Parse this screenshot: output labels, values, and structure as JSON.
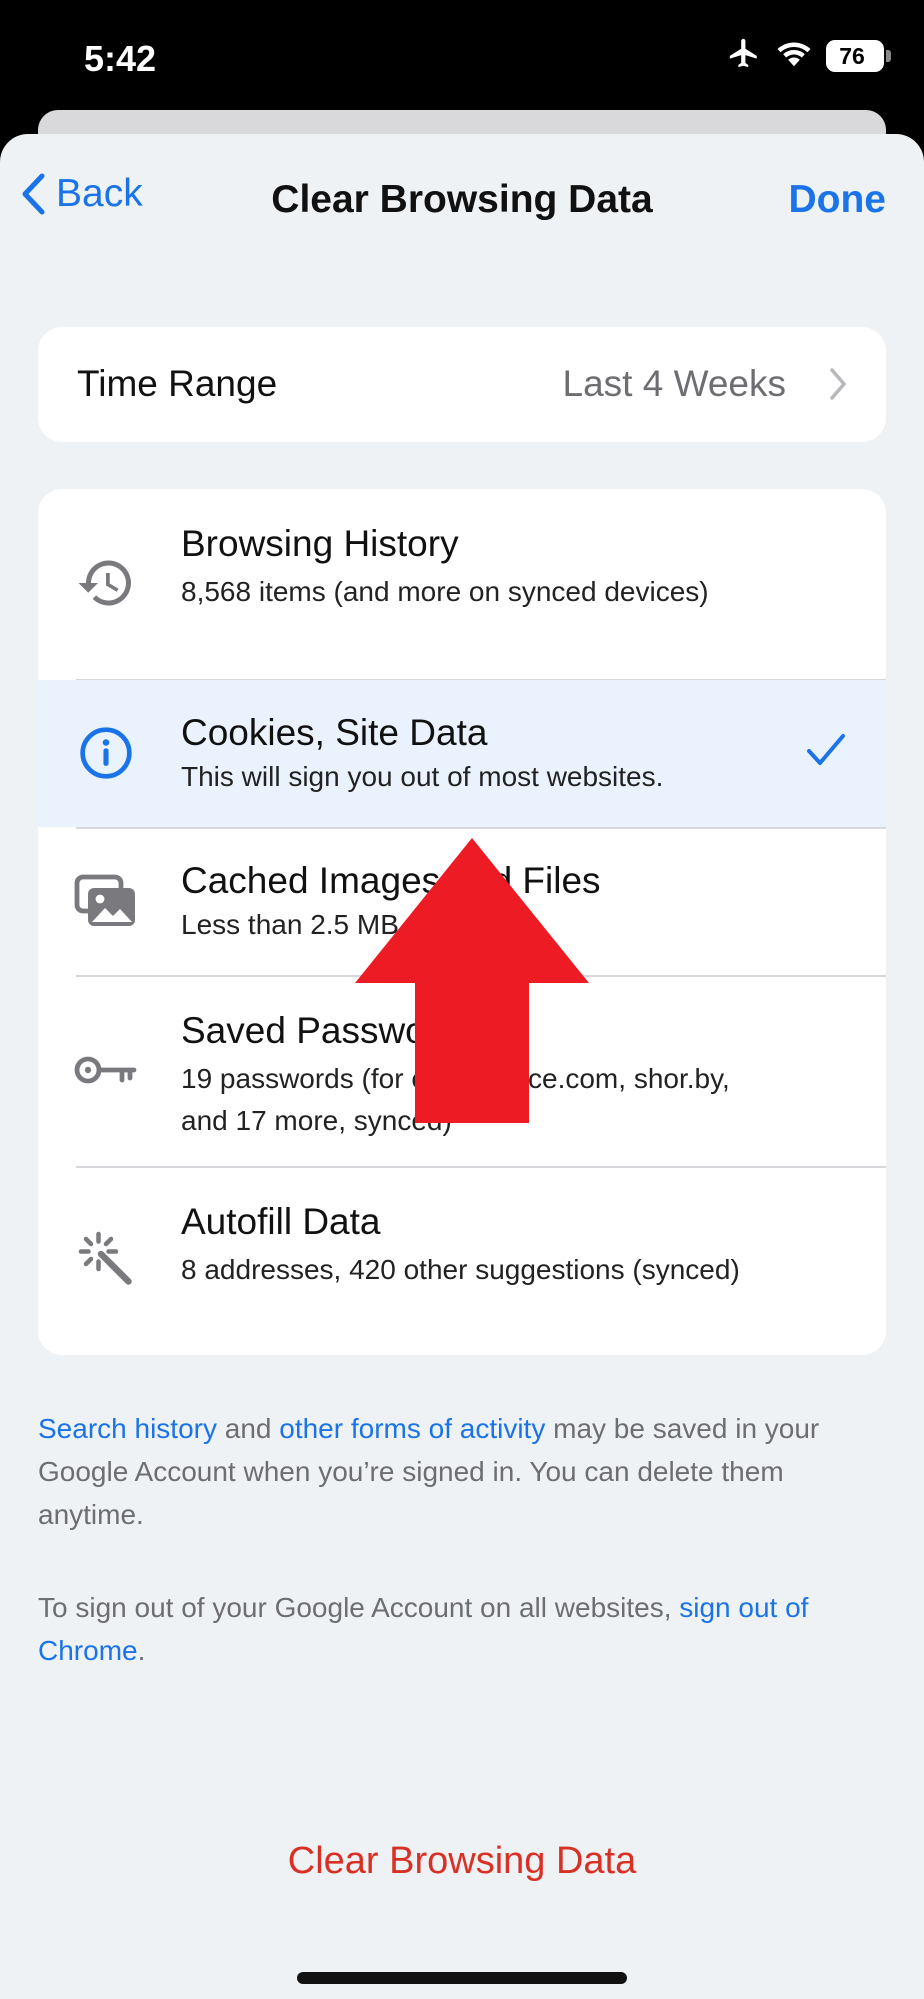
{
  "status_bar": {
    "time": "5:42",
    "battery": "76"
  },
  "nav": {
    "back_label": "Back",
    "title": "Clear Browsing Data",
    "done_label": "Done"
  },
  "time_range": {
    "label": "Time Range",
    "value": "Last 4 Weeks"
  },
  "items": [
    {
      "title": "Browsing History",
      "subtitle": "8,568 items (and more on synced devices)",
      "icon": "history-icon",
      "selected": false
    },
    {
      "title": "Cookies, Site Data",
      "subtitle": "This will sign you out of most websites.",
      "icon": "info-icon",
      "selected": true
    },
    {
      "title": "Cached Images and Files",
      "subtitle": "Less than 2.5 MB",
      "icon": "images-icon",
      "selected": false
    },
    {
      "title": "Saved Passwords",
      "subtitle": "19 passwords (for ecommerce.com, shor.by, and 17 more, synced)",
      "icon": "key-icon",
      "selected": false
    },
    {
      "title": "Autofill Data",
      "subtitle": "8 addresses, 420 other suggestions (synced)",
      "icon": "magic-wand-icon",
      "selected": false
    }
  ],
  "footer": {
    "link1": "Search history",
    "text1": " and ",
    "link2": "other forms of activity",
    "text2": " may be saved in your Google Account when you’re signed in. You can delete them anytime.",
    "text3": "To sign out of your Google Account on all websites, ",
    "link3": "sign out of Chrome",
    "text4": "."
  },
  "clear_button": "Clear Browsing Data",
  "colors": {
    "accent": "#1a73e8",
    "destructive": "#d93025",
    "overlay_arrow": "#ed1c24",
    "selected_row": "#eaf3fd"
  }
}
